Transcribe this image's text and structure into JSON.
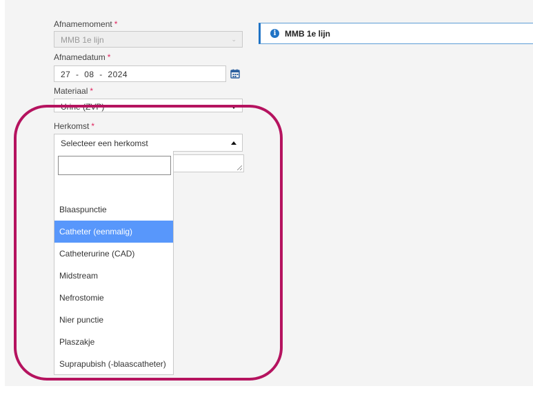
{
  "form": {
    "afnamemoment": {
      "label": "Afnamemoment",
      "required_mark": "*",
      "value": "MMB 1e lijn"
    },
    "afnamedatum": {
      "label": "Afnamedatum",
      "required_mark": "*",
      "day": "27",
      "month": "08",
      "year": "2024",
      "separator": "-"
    },
    "materiaal": {
      "label": "Materiaal",
      "required_mark": "*",
      "value": "Urine (ZVP)"
    },
    "herkomst": {
      "label": "Herkomst",
      "required_mark": "*",
      "placeholder": "Selecteer een herkomst",
      "options": [
        {
          "label": "Blaaspunctie"
        },
        {
          "label": "Catheter (eenmalig)"
        },
        {
          "label": "Catheterurine (CAD)"
        },
        {
          "label": "Midstream"
        },
        {
          "label": "Nefrostomie"
        },
        {
          "label": "Nier punctie"
        },
        {
          "label": "Plaszakje"
        },
        {
          "label": "Suprapubish (-blaascatheter)"
        }
      ],
      "highlighted": "Catheter (eenmalig)"
    }
  },
  "info": {
    "text": "MMB 1e lijn"
  },
  "icons": {
    "info": "info-icon",
    "calendar": "calendar-icon",
    "chevron": "chevron-down-icon",
    "caret": "caret-up-icon"
  },
  "colors": {
    "highlight": "#5897fb",
    "annotation": "#b5135f",
    "info_accent": "#1f73c5",
    "required": "#e0245e"
  }
}
